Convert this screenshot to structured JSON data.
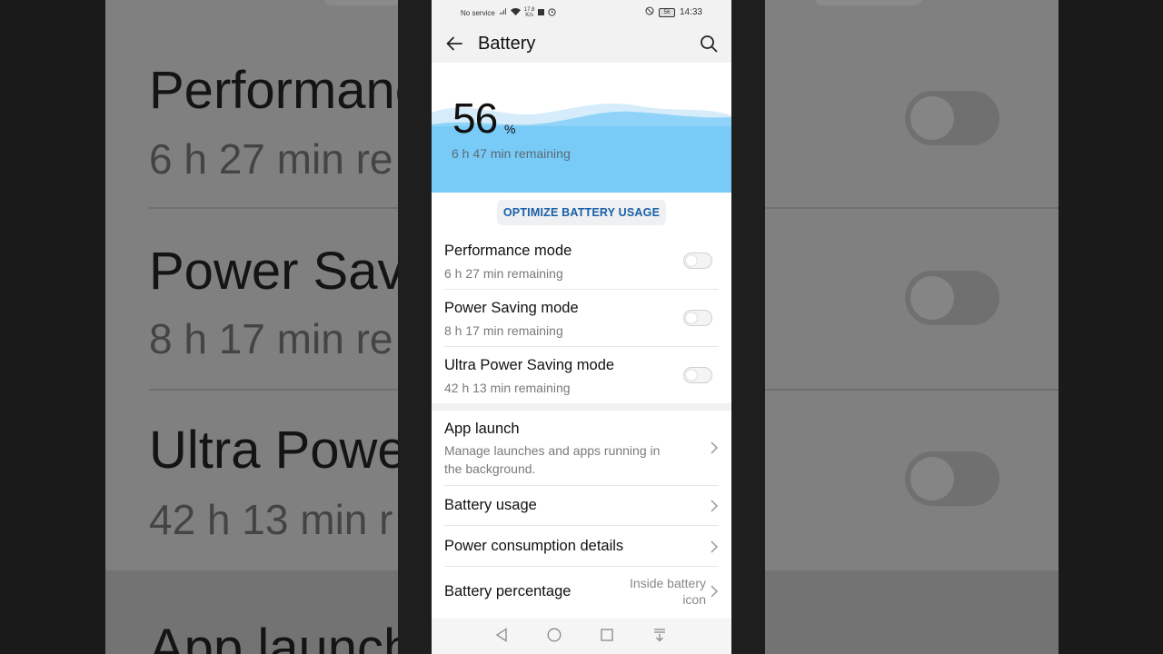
{
  "status_bar": {
    "carrier": "No service",
    "speed_value": "17.8",
    "speed_unit": "K/s",
    "battery_level": "56",
    "time": "14:33"
  },
  "app_bar": {
    "title": "Battery"
  },
  "battery": {
    "percent": "56",
    "percent_sign": "%",
    "remaining": "6 h 47 min remaining"
  },
  "optimize_label": "OPTIMIZE BATTERY USAGE",
  "modes": [
    {
      "title": "Performance mode",
      "subtitle": "6 h 27 min remaining",
      "enabled": false
    },
    {
      "title": "Power Saving mode",
      "subtitle": "8 h 17 min remaining",
      "enabled": false
    },
    {
      "title": "Ultra Power Saving mode",
      "subtitle": "42 h 13 min remaining",
      "enabled": false
    }
  ],
  "settings": [
    {
      "title": "App launch",
      "subtitle_line1": "Manage launches and apps running in",
      "subtitle_line2": "the background."
    },
    {
      "title": "Battery usage"
    },
    {
      "title": "Power consumption details"
    },
    {
      "title": "Battery percentage",
      "value_line1": "Inside battery",
      "value_line2": "icon"
    }
  ],
  "background_zoom": {
    "rows": [
      {
        "title": "Performanc",
        "subtitle": "6 h 27 min re"
      },
      {
        "title": "Power Savi",
        "subtitle": "8 h 17 min re"
      },
      {
        "title": "Ultra Powe",
        "subtitle": "42 h 13 min r"
      },
      {
        "title": "App launch"
      }
    ]
  },
  "colors": {
    "accent": "#1a5fa8",
    "wave_light": "#cfe9fb",
    "wave_dark": "#5bc1f5"
  }
}
